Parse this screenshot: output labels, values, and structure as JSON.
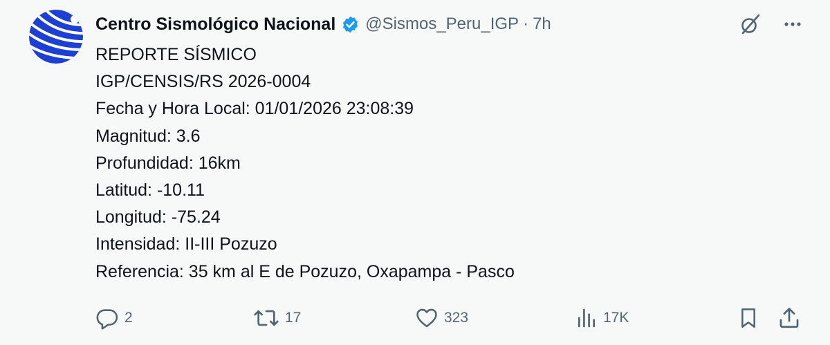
{
  "post": {
    "author_name": "Centro Sismológico Nacional",
    "handle": "@Sismos_Peru_IGP",
    "separator": "·",
    "time": "7h",
    "verified_color": "#1d9bf0",
    "avatar_icon": "igp-logo-icon",
    "lines": [
      "REPORTE SÍSMICO",
      "IGP/CENSIS/RS 2026-0004",
      "Fecha y Hora Local: 01/01/2026 23:08:39",
      "Magnitud: 3.6",
      "Profundidad: 16km",
      "Latitud: -10.11",
      "Longitud: -75.24",
      "Intensidad: II-III Pozuzo",
      "Referencia: 35 km al E de Pozuzo, Oxapampa - Pasco"
    ]
  },
  "top_actions": {
    "grok_icon": "grok-icon",
    "more_icon": "more-icon"
  },
  "actions": {
    "reply_count": "2",
    "repost_count": "17",
    "like_count": "323",
    "views_count": "17K",
    "icons": [
      "reply-icon",
      "repost-icon",
      "like-icon",
      "views-icon",
      "bookmark-icon",
      "share-icon"
    ]
  },
  "colors": {
    "background": "#f7f9f9",
    "text": "#0f1419",
    "muted": "#536471",
    "avatar_blue": "#1d3fd3"
  }
}
